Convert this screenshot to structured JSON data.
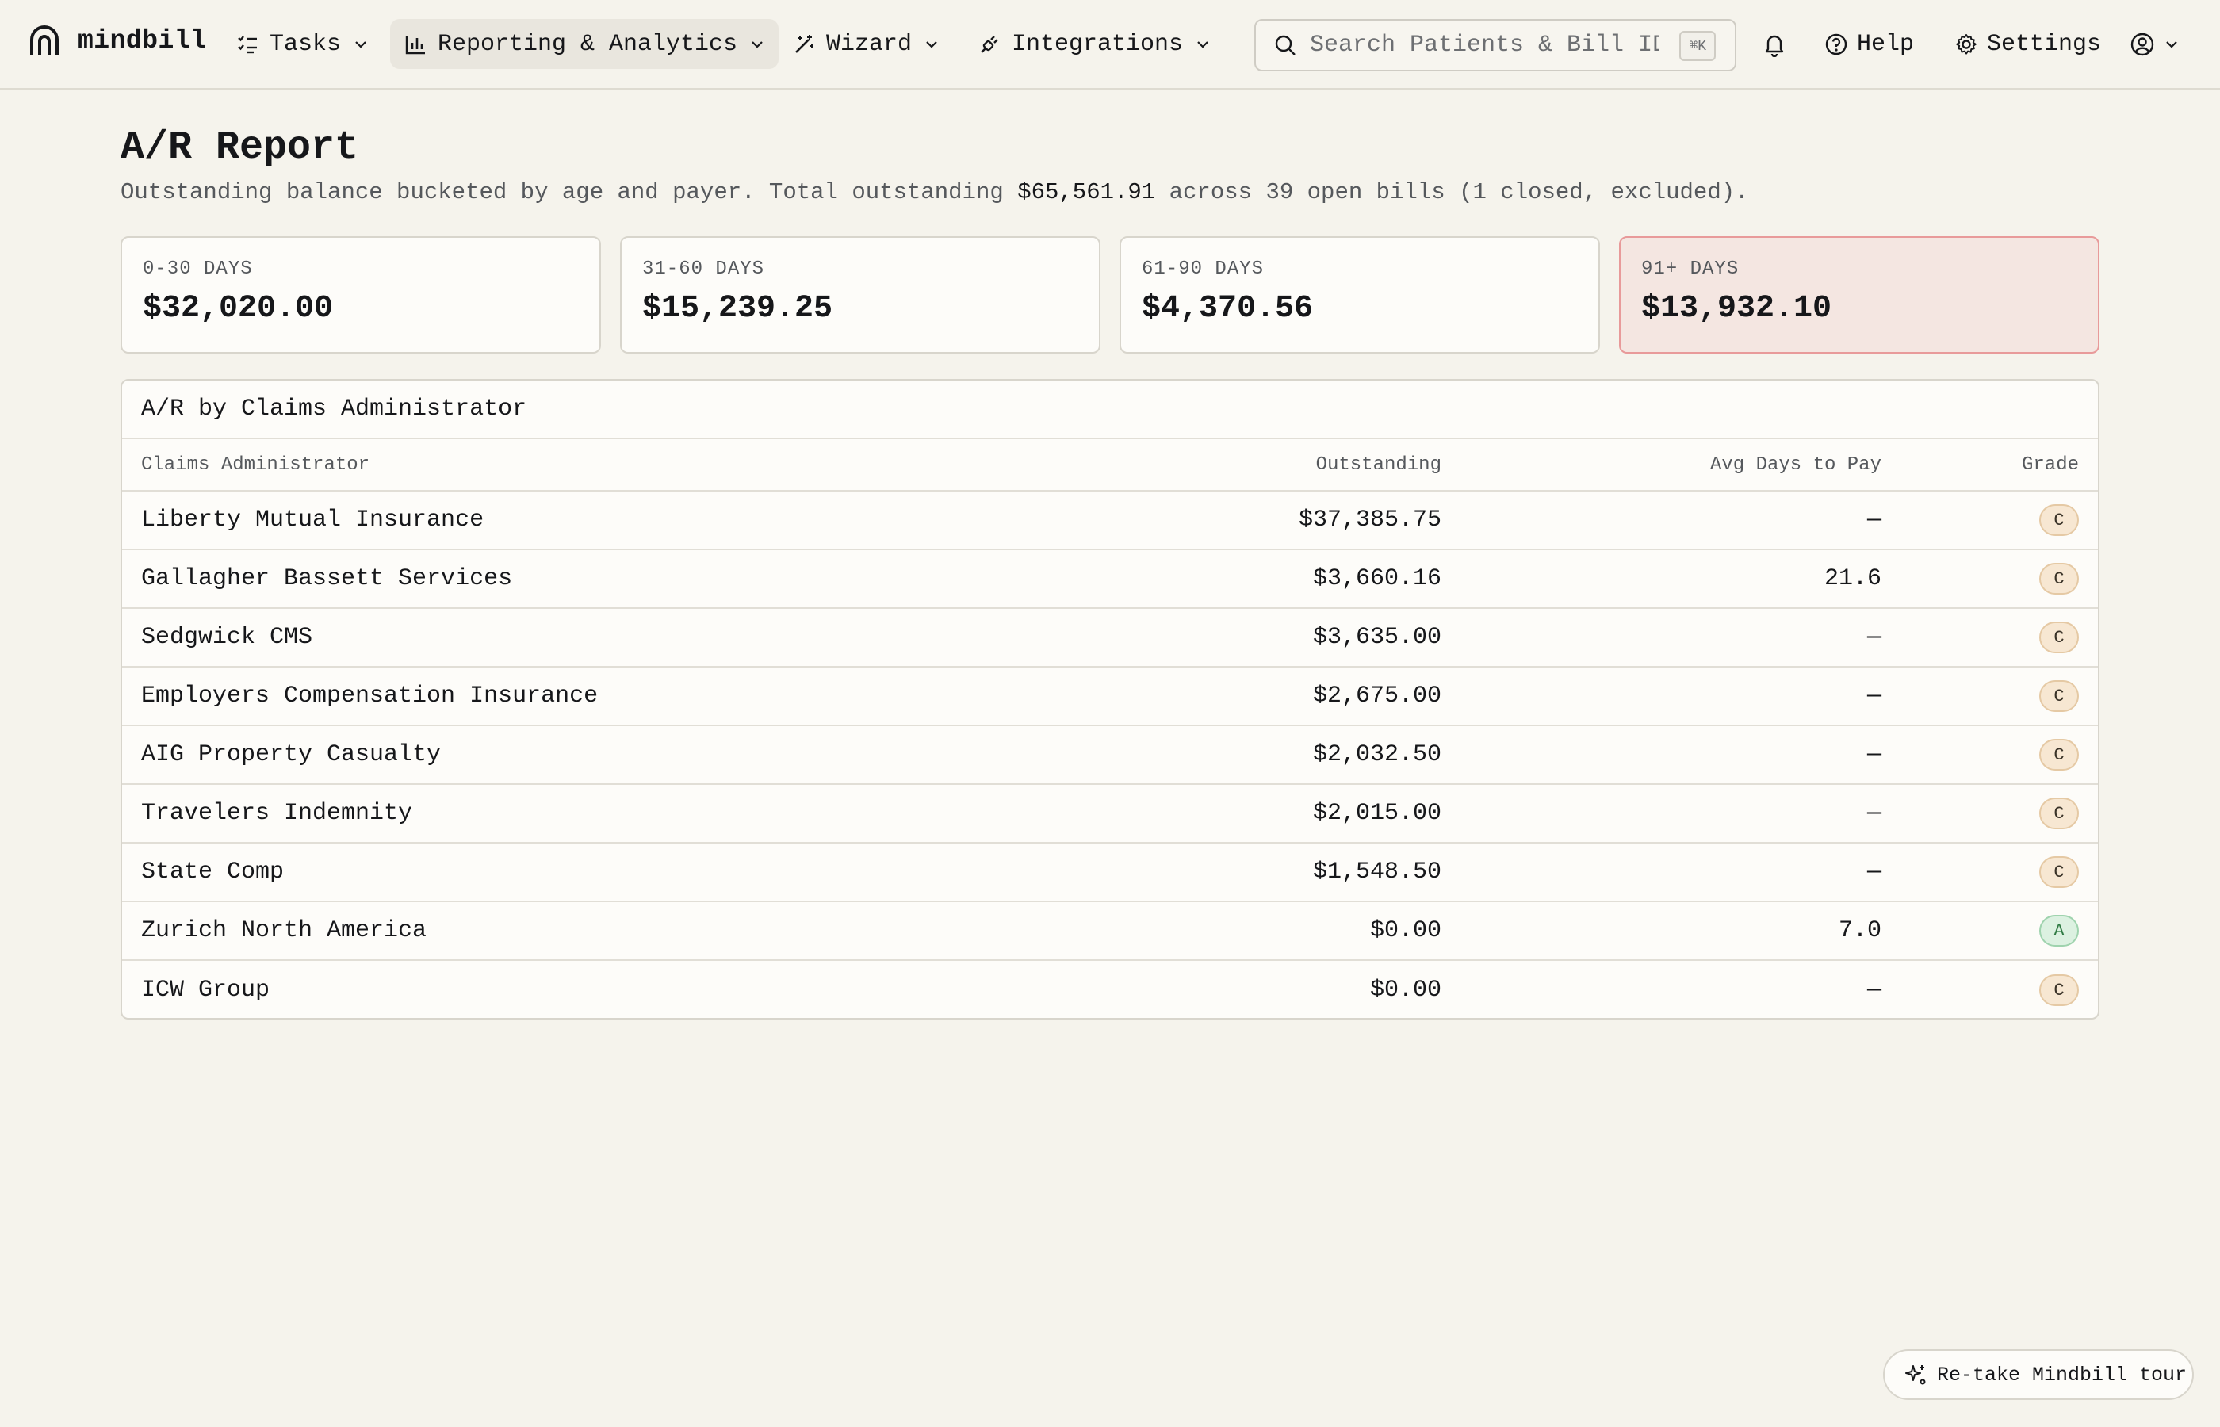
{
  "brand": {
    "name": "mindbill"
  },
  "nav": [
    {
      "label": "Tasks",
      "icon": "task-list-icon"
    },
    {
      "label": "Reporting & Analytics",
      "icon": "bar-chart-icon",
      "active": true
    },
    {
      "label": "Wizard",
      "icon": "magic-wand-icon"
    },
    {
      "label": "Integrations",
      "icon": "plug-icon"
    }
  ],
  "search": {
    "placeholder": "Search Patients & Bill IDs",
    "shortcut": "⌘K"
  },
  "header_actions": {
    "help_label": "Help",
    "settings_label": "Settings"
  },
  "page": {
    "title": "A/R Report",
    "subtitle_prefix": "Outstanding balance bucketed by age and payer. Total outstanding ",
    "total_outstanding": "$65,561.91",
    "subtitle_suffix": " across 39 open bills (1 closed, excluded)."
  },
  "buckets": [
    {
      "label": "0-30 DAYS",
      "value": "$32,020.00"
    },
    {
      "label": "31-60 DAYS",
      "value": "$15,239.25"
    },
    {
      "label": "61-90 DAYS",
      "value": "$4,370.56"
    },
    {
      "label": "91+ DAYS",
      "value": "$13,932.10"
    }
  ],
  "table": {
    "title": "A/R by Claims Administrator",
    "columns": {
      "name": "Claims Administrator",
      "outstanding": "Outstanding",
      "avg_days": "Avg Days to Pay",
      "grade": "Grade"
    },
    "rows": [
      {
        "name": "Liberty Mutual Insurance",
        "outstanding": "$37,385.75",
        "avg_days": "—",
        "grade": "C"
      },
      {
        "name": "Gallagher Bassett Services",
        "outstanding": "$3,660.16",
        "avg_days": "21.6",
        "grade": "C"
      },
      {
        "name": "Sedgwick CMS",
        "outstanding": "$3,635.00",
        "avg_days": "—",
        "grade": "C"
      },
      {
        "name": "Employers Compensation Insurance",
        "outstanding": "$2,675.00",
        "avg_days": "—",
        "grade": "C"
      },
      {
        "name": "AIG Property Casualty",
        "outstanding": "$2,032.50",
        "avg_days": "—",
        "grade": "C"
      },
      {
        "name": "Travelers Indemnity",
        "outstanding": "$2,015.00",
        "avg_days": "—",
        "grade": "C"
      },
      {
        "name": "State Comp",
        "outstanding": "$1,548.50",
        "avg_days": "—",
        "grade": "C"
      },
      {
        "name": "Zurich North America",
        "outstanding": "$0.00",
        "avg_days": "7.0",
        "grade": "A"
      },
      {
        "name": "ICW Group",
        "outstanding": "$0.00",
        "avg_days": "—",
        "grade": "C"
      }
    ]
  },
  "tour": {
    "label": "Re-take Mindbill tour"
  },
  "colors": {
    "background": "#f5f3ec",
    "danger_card_bg": "#f4e6e1",
    "danger_card_border": "#e89a9a",
    "grade_c_bg": "#f7e7d2",
    "grade_a_bg": "#dcf1e1"
  }
}
